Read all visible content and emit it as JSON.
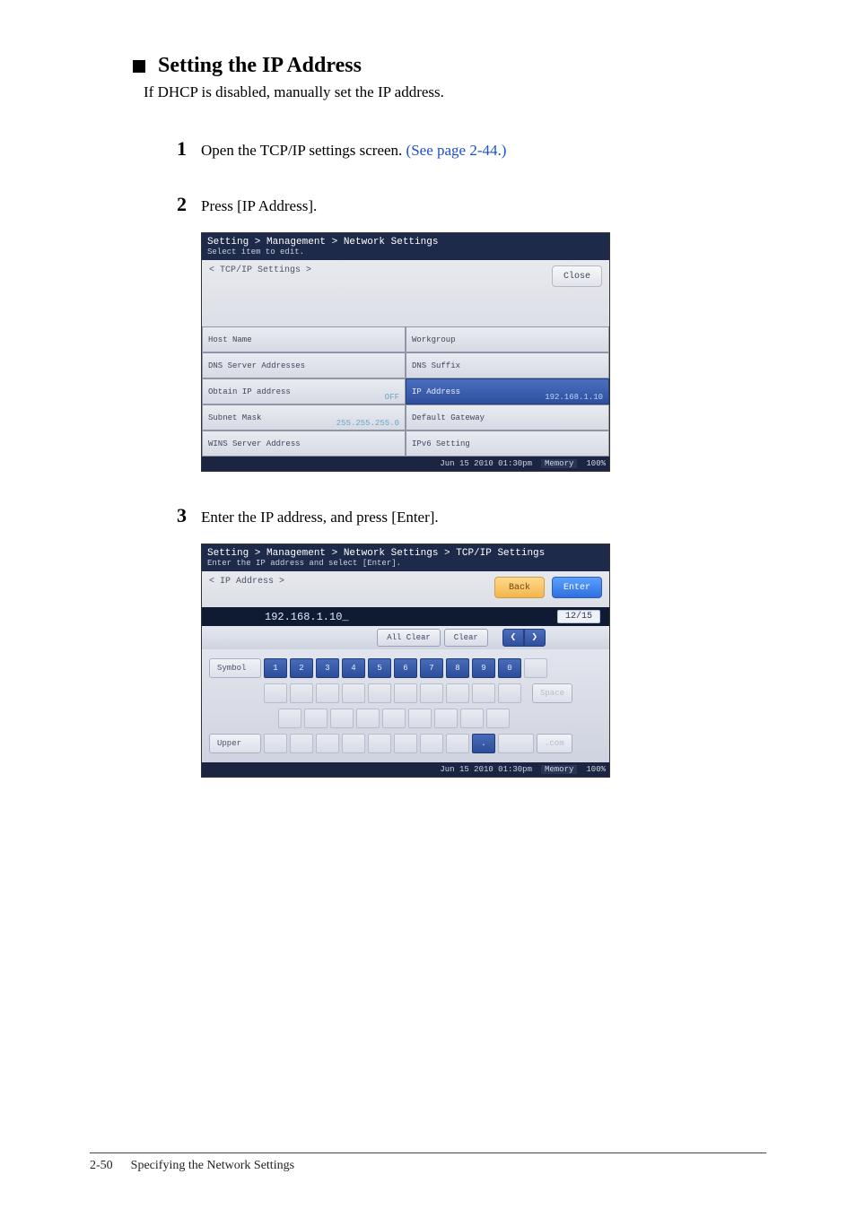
{
  "heading": "Setting the IP Address",
  "intro": "If DHCP is disabled, manually set the IP address.",
  "steps": {
    "s1": {
      "num": "1",
      "text": "Open the TCP/IP settings screen. ",
      "link": "(See page 2-44.)"
    },
    "s2": {
      "num": "2",
      "text": "Press [IP Address]."
    },
    "s3": {
      "num": "3",
      "text": "Enter the IP address, and press [Enter]."
    }
  },
  "shot1": {
    "crumb": "Setting > Management > Network Settings",
    "sub": "Select item to edit.",
    "section_label": "< TCP/IP Settings >",
    "close": "Close",
    "cells": {
      "host_name": "Host Name",
      "workgroup": "Workgroup",
      "dns_server": "DNS Server Addresses",
      "dns_suffix": "DNS Suffix",
      "obtain_ip": "Obtain IP address",
      "obtain_ip_val": "OFF",
      "ip_address": "IP Address",
      "ip_address_val": "192.168.1.10",
      "subnet": "Subnet Mask",
      "subnet_val": "255.255.255.0",
      "gateway": "Default Gateway",
      "wins": "WINS Server Address",
      "ipv6": "IPv6 Setting"
    },
    "datetime": "Jun 15 2010 01:30pm",
    "memory": "Memory",
    "mempct": "100%"
  },
  "shot2": {
    "crumb": "Setting > Management > Network Settings > TCP/IP Settings",
    "sub": "Enter the IP address and select [Enter].",
    "section_label": "< IP Address >",
    "back": "Back",
    "enter": "Enter",
    "input_value": "192.168.1.10_",
    "count": "12/15",
    "allclear": "All Clear",
    "clear": "Clear",
    "symbol": "Symbol",
    "space": "Space",
    "upper": "Upper",
    "dotcom": ".com",
    "row1": [
      "1",
      "2",
      "3",
      "4",
      "5",
      "6",
      "7",
      "8",
      "9",
      "0"
    ],
    "row3_dot": ".",
    "datetime": "Jun 15 2010 01:30pm",
    "memory": "Memory",
    "mempct": "100%"
  },
  "footer": {
    "pagenum": "2-50",
    "title": "Specifying the Network Settings"
  }
}
